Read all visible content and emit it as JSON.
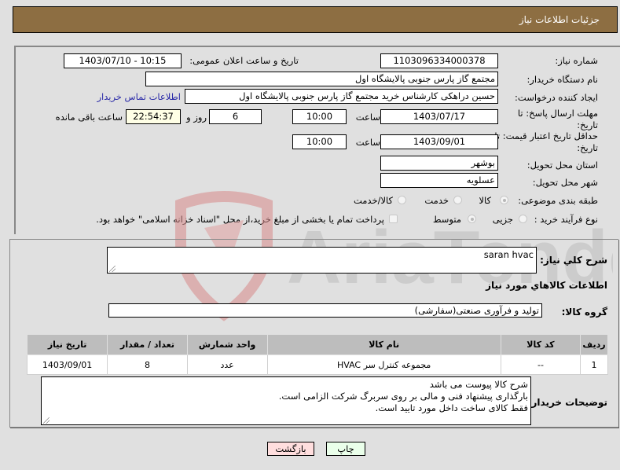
{
  "header": {
    "title": "جزئیات اطلاعات نیاز"
  },
  "form": {
    "need_number": {
      "label": "شماره نیاز:",
      "value": "1103096334000378"
    },
    "announce_datetime": {
      "label": "تاریخ و ساعت اعلان عمومی:",
      "value": "1403/07/10 - 10:15"
    },
    "buyer_org": {
      "label": "نام دستگاه خریدار:",
      "value": "مجتمع گاز پارس جنوبی  پالایشگاه اول"
    },
    "requester": {
      "label": "ایجاد کننده درخواست:",
      "value": "حسین دراهکی کارشناس خرید مجتمع گاز پارس جنوبی  پالایشگاه اول",
      "contact_link": "اطلاعات تماس خریدار"
    },
    "response_deadline": {
      "label_line1": "مهلت ارسال پاسخ: تا",
      "label_line2": "تاریخ:",
      "date": "1403/07/17",
      "time_label": "ساعت",
      "time": "10:00",
      "days": "6",
      "days_label": "روز و",
      "remaining": "22:54:37",
      "remaining_label": "ساعت باقی مانده"
    },
    "price_validity": {
      "label_line1": "حداقل تاریخ اعتبار قیمت: تا",
      "label_line2": "تاریخ:",
      "date": "1403/09/01",
      "time_label": "ساعت",
      "time": "10:00"
    },
    "delivery_province": {
      "label": "استان محل تحویل:",
      "value": "بوشهر"
    },
    "delivery_city": {
      "label": "شهر محل تحویل:",
      "value": "عسلویه"
    },
    "category": {
      "label": "طبقه بندی موضوعی:",
      "options": [
        "کالا",
        "خدمت",
        "کالا/خدمت"
      ],
      "selected": "کالا"
    },
    "purchase_type": {
      "label": "نوع فرآیند خرید :",
      "options": [
        "جزیی",
        "متوسط"
      ],
      "selected": "متوسط",
      "treasury_note": "پرداخت تمام یا بخشی از مبلغ خرید،از محل \"اسناد خزانه اسلامی\" خواهد بود."
    }
  },
  "details": {
    "summary_label": "شرح کلي نياز:",
    "summary_value": "saran hvac",
    "goods_section_title": "اطلاعات کالاهاي مورد نياز",
    "goods_group_label": "گروه کالا:",
    "goods_group_value": "تولید و فرآوری صنعتی(سفارشی)",
    "table": {
      "headers": [
        "ردیف",
        "کد کالا",
        "نام کالا",
        "واحد شمارش",
        "تعداد / مقدار",
        "تاریخ نیاز"
      ],
      "rows": [
        [
          "1",
          "--",
          "مجموعه کنترل سر HVAC",
          "عدد",
          "8",
          "1403/09/01"
        ]
      ]
    },
    "buyer_notes_label": "توضیحات خریدار:",
    "buyer_notes_lines": [
      "شرح کالا پیوست می باشد",
      "بارگذاری پیشنهاد فنی و مالی بر روی سربرگ شرکت الزامی است.",
      "فقط کالای ساخت داخل مورد تایید است."
    ]
  },
  "buttons": {
    "print": "چاپ",
    "back": "بازگشت"
  },
  "watermark": {
    "text": "AriaTender.net"
  },
  "colors": {
    "header_bg": "#8d6e42",
    "link": "#2a2aa8",
    "print_bg": "#eaffea",
    "back_bg": "#ffdede"
  }
}
